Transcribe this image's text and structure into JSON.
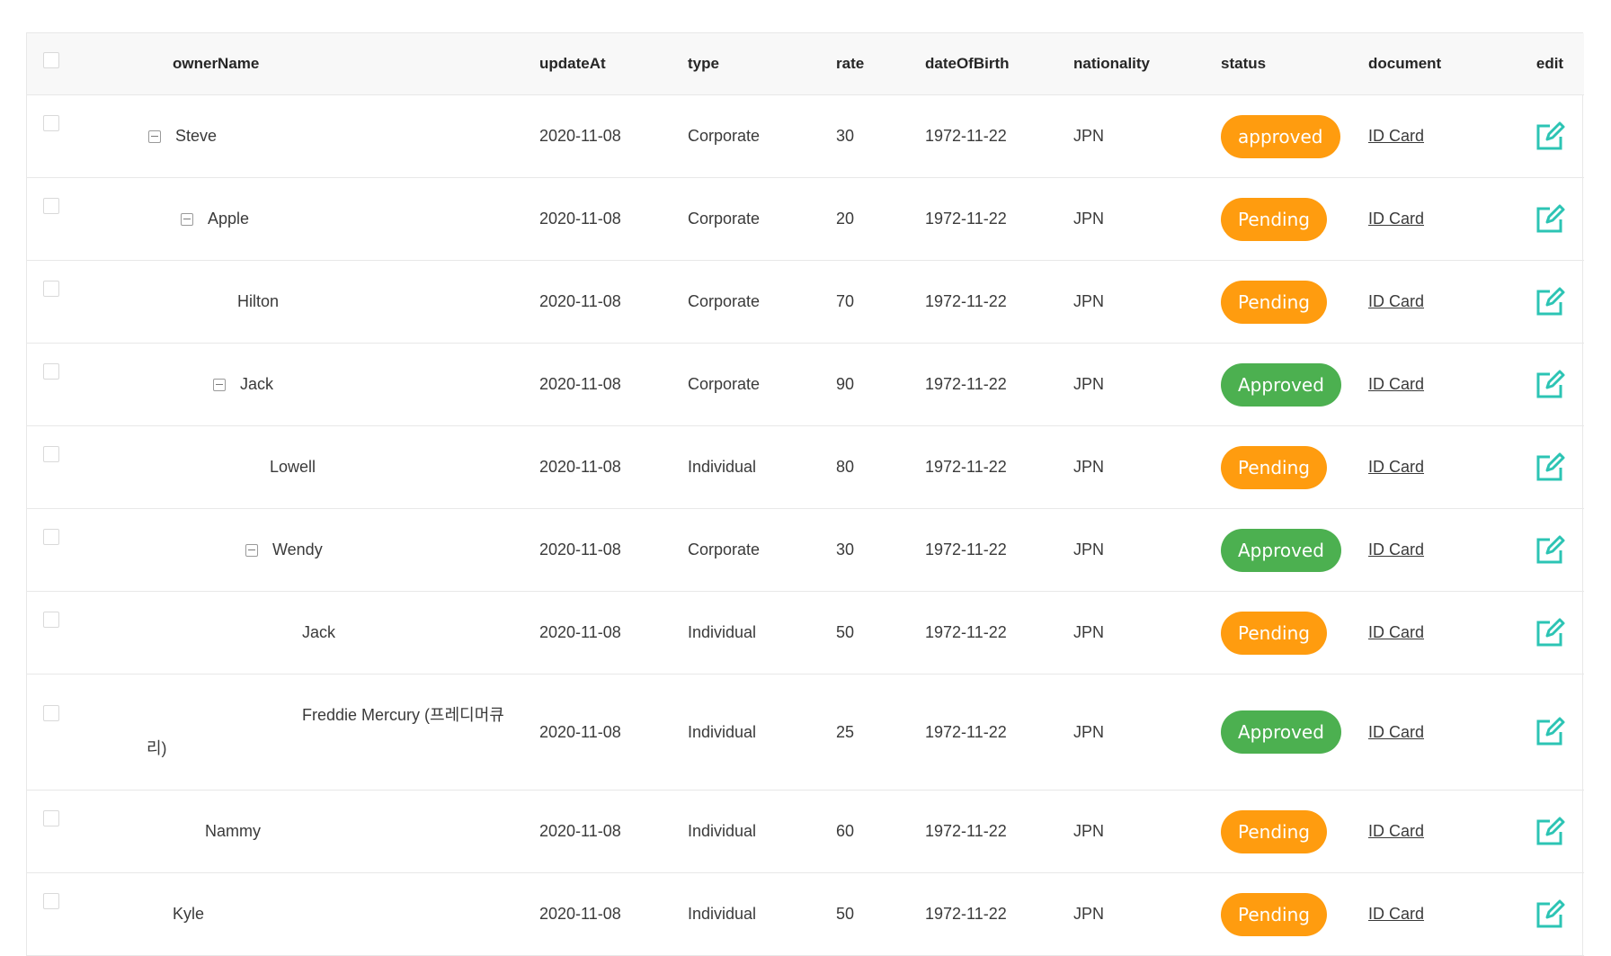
{
  "table": {
    "columns": {
      "ownerName": "ownerName",
      "updateAt": "updateAt",
      "type": "type",
      "rate": "rate",
      "dateOfBirth": "dateOfBirth",
      "nationality": "nationality",
      "status": "status",
      "document": "document",
      "edit": "edit"
    },
    "rows": [
      {
        "ownerName": "Steve",
        "updateAt": "2020-11-08",
        "type": "Corporate",
        "rate": "30",
        "dateOfBirth": "1972-11-22",
        "nationality": "JPN",
        "status": "approved",
        "document": "ID Card"
      },
      {
        "ownerName": "Apple",
        "updateAt": "2020-11-08",
        "type": "Corporate",
        "rate": "20",
        "dateOfBirth": "1972-11-22",
        "nationality": "JPN",
        "status": "Pending",
        "document": "ID Card"
      },
      {
        "ownerName": "Hilton",
        "updateAt": "2020-11-08",
        "type": "Corporate",
        "rate": "70",
        "dateOfBirth": "1972-11-22",
        "nationality": "JPN",
        "status": "Pending",
        "document": "ID Card"
      },
      {
        "ownerName": "Jack",
        "updateAt": "2020-11-08",
        "type": "Corporate",
        "rate": "90",
        "dateOfBirth": "1972-11-22",
        "nationality": "JPN",
        "status": "Approved",
        "document": "ID Card"
      },
      {
        "ownerName": "Lowell",
        "updateAt": "2020-11-08",
        "type": "Individual",
        "rate": "80",
        "dateOfBirth": "1972-11-22",
        "nationality": "JPN",
        "status": "Pending",
        "document": "ID Card"
      },
      {
        "ownerName": "Wendy",
        "updateAt": "2020-11-08",
        "type": "Corporate",
        "rate": "30",
        "dateOfBirth": "1972-11-22",
        "nationality": "JPN",
        "status": "Approved",
        "document": "ID Card"
      },
      {
        "ownerName": "Jack",
        "updateAt": "2020-11-08",
        "type": "Individual",
        "rate": "50",
        "dateOfBirth": "1972-11-22",
        "nationality": "JPN",
        "status": "Pending",
        "document": "ID Card"
      },
      {
        "ownerName": "Freddie Mercury (프레디머큐리)",
        "updateAt": "2020-11-08",
        "type": "Individual",
        "rate": "25",
        "dateOfBirth": "1972-11-22",
        "nationality": "JPN",
        "status": "Approved",
        "document": "ID Card"
      },
      {
        "ownerName": "Nammy",
        "updateAt": "2020-11-08",
        "type": "Individual",
        "rate": "60",
        "dateOfBirth": "1972-11-22",
        "nationality": "JPN",
        "status": "Pending",
        "document": "ID Card"
      },
      {
        "ownerName": "Kyle",
        "updateAt": "2020-11-08",
        "type": "Individual",
        "rate": "50",
        "dateOfBirth": "1972-11-22",
        "nationality": "JPN",
        "status": "Pending",
        "document": "ID Card"
      }
    ]
  },
  "colors": {
    "approved_badge": "#4cb050",
    "pending_badge": "#ff9c0f",
    "edit_icon": "#2cc4b4",
    "header_bg": "#f8f8f8",
    "border": "#e8e8e8"
  },
  "icons": {
    "expand": "minus-square-icon",
    "edit": "edit-pencil-icon"
  }
}
